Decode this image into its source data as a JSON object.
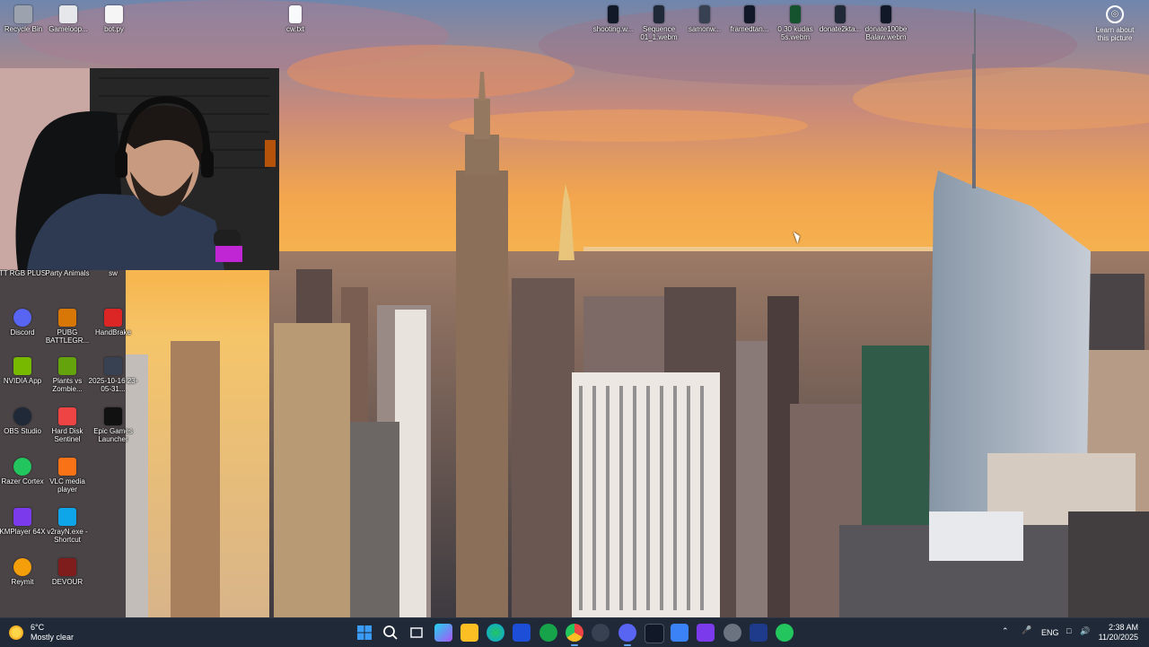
{
  "desktop": {
    "top_icons": [
      {
        "label": "Recycle Bin",
        "icon": "recycle-bin-icon",
        "color": "#9ca3af"
      },
      {
        "label": "Gameloop...",
        "icon": "gameloop-icon",
        "color": "#e5e7eb"
      },
      {
        "label": "bot.py",
        "icon": "python-file-icon",
        "color": "#f5f5f5"
      },
      {
        "label": "cw.txt",
        "icon": "text-file-icon",
        "color": "#f9fafb"
      },
      {
        "label": "shooting.w...",
        "icon": "video-file-icon",
        "color": "#111827"
      },
      {
        "label": "Sequence 01_1.webm",
        "icon": "video-file-icon",
        "color": "#1f2937"
      },
      {
        "label": "samonw...",
        "icon": "video-file-icon",
        "color": "#374151"
      },
      {
        "label": "framedtan...",
        "icon": "video-file-icon",
        "color": "#111827"
      },
      {
        "label": "0 30 kudas 5s.webm",
        "icon": "video-file-icon",
        "color": "#14532d"
      },
      {
        "label": "donate2kta...",
        "icon": "video-file-icon",
        "color": "#1f2937"
      },
      {
        "label": "donate100be Balaw.webm",
        "icon": "video-file-icon",
        "color": "#111827"
      }
    ],
    "left_icons": [
      {
        "label": "TT RGB PLUS",
        "icon": "rgb-icon",
        "color": "#3b82f6"
      },
      {
        "label": "Party Animals",
        "icon": "game-icon",
        "color": "#f97316"
      },
      {
        "label": "sw",
        "icon": "file-icon",
        "color": "#e5e7eb"
      },
      {
        "label": "Discord",
        "icon": "discord-icon",
        "color": "#5865f2"
      },
      {
        "label": "PUBG BATTLEGR...",
        "icon": "pubg-icon",
        "color": "#d97706"
      },
      {
        "label": "HandBrake",
        "icon": "handbrake-icon",
        "color": "#dc2626"
      },
      {
        "label": "NVIDIA App",
        "icon": "nvidia-icon",
        "color": "#76b900"
      },
      {
        "label": "Plants vs Zombie...",
        "icon": "game-icon",
        "color": "#65a30d"
      },
      {
        "label": "2025-10-16 23-05-31...",
        "icon": "video-file-icon",
        "color": "#374151"
      },
      {
        "label": "OBS Studio",
        "icon": "obs-icon",
        "color": "#1f2937"
      },
      {
        "label": "Hard Disk Sentinel",
        "icon": "disk-icon",
        "color": "#ef4444"
      },
      {
        "label": "Epic Games Launcher",
        "icon": "epic-icon",
        "color": "#111111"
      },
      {
        "label": "Razer Cortex",
        "icon": "razer-icon",
        "color": "#22c55e"
      },
      {
        "label": "VLC media player",
        "icon": "vlc-icon",
        "color": "#f97316"
      },
      {
        "label": "KMPlayer 64X",
        "icon": "kmplayer-icon",
        "color": "#7c3aed"
      },
      {
        "label": "v2rayN.exe - Shortcut",
        "icon": "v2ray-icon",
        "color": "#0ea5e9"
      },
      {
        "label": "Reymit",
        "icon": "reymit-icon",
        "color": "#f59e0b"
      },
      {
        "label": "DEVOUR",
        "icon": "game-icon",
        "color": "#7f1d1d"
      }
    ],
    "learn_picture": {
      "label": "Learn about this picture"
    }
  },
  "taskbar": {
    "weather": {
      "temp": "6°C",
      "condition": "Mostly clear"
    },
    "apps": [
      {
        "name": "start-button",
        "color": "#3b82f6"
      },
      {
        "name": "search-icon",
        "color": "#ffffff"
      },
      {
        "name": "task-view-icon",
        "color": "#e5e7eb"
      },
      {
        "name": "widgets-icon",
        "color": "#22d3ee"
      },
      {
        "name": "file-explorer-icon",
        "color": "#fbbf24"
      },
      {
        "name": "edge-icon",
        "color": "#0ea5e9"
      },
      {
        "name": "store-icon",
        "color": "#60a5fa"
      },
      {
        "name": "utorrent-icon",
        "color": "#16a34a"
      },
      {
        "name": "chrome-icon",
        "color": "#ef4444"
      },
      {
        "name": "steam-dark-icon",
        "color": "#4b5563"
      },
      {
        "name": "discord-icon",
        "color": "#5865f2"
      },
      {
        "name": "terminal-icon",
        "color": "#111827"
      },
      {
        "name": "vscode-icon",
        "color": "#3b82f6"
      },
      {
        "name": "r-app-icon",
        "color": "#7c3aed"
      },
      {
        "name": "github-icon",
        "color": "#6b7280"
      },
      {
        "name": "steam-icon",
        "color": "#1e3a8a"
      },
      {
        "name": "nvidia-tray-app-icon",
        "color": "#22c55e"
      }
    ],
    "tray": {
      "lang": "ENG"
    },
    "clock": {
      "time": "2:38 AM",
      "date": "11/20/2025"
    }
  }
}
